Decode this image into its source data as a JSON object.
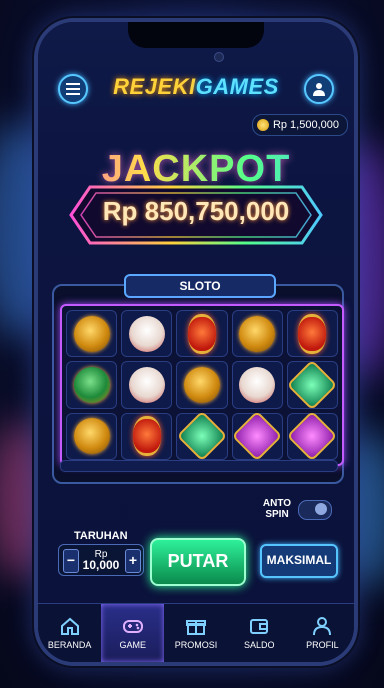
{
  "app": {
    "logo_part1": "REJEKI",
    "logo_part2": "GAMES"
  },
  "balance": {
    "text": "Rp 1,500,000"
  },
  "jackpot": {
    "title": "JACKPOT",
    "amount": "Rp 850,750,000"
  },
  "machine": {
    "label": "SLOTO",
    "reels": [
      [
        "dragon-gold",
        "dragon-green",
        "dragon-gold"
      ],
      [
        "lucky-cat",
        "lucky-cat",
        "lantern"
      ],
      [
        "lantern",
        "dragon-gold",
        "gem-green"
      ],
      [
        "dragon-gold",
        "lucky-cat",
        "gem-purple"
      ],
      [
        "lantern",
        "gem-green",
        "gem-purple"
      ]
    ]
  },
  "controls": {
    "auto_spin_line1": "ANTO",
    "auto_spin_line2": "SPIN",
    "auto_spin_on": false,
    "bet_label": "TARUHAN",
    "bet_currency": "Rp",
    "bet_value": "10,000",
    "minus": "−",
    "plus": "+",
    "spin_label": "PUTAR",
    "max_label": "MAKSIMAL"
  },
  "nav": {
    "items": [
      {
        "label": "BERANDA",
        "icon": "home-icon"
      },
      {
        "label": "GAME",
        "icon": "gamepad-icon",
        "active": true
      },
      {
        "label": "PROMOSI",
        "icon": "gift-icon"
      },
      {
        "label": "SALDO",
        "icon": "wallet-icon"
      },
      {
        "label": "PROFIL",
        "icon": "user-icon"
      }
    ]
  },
  "colors": {
    "accent": "#57c8ff",
    "spin": "#2ef09a",
    "reel_border": "#c45bff"
  }
}
